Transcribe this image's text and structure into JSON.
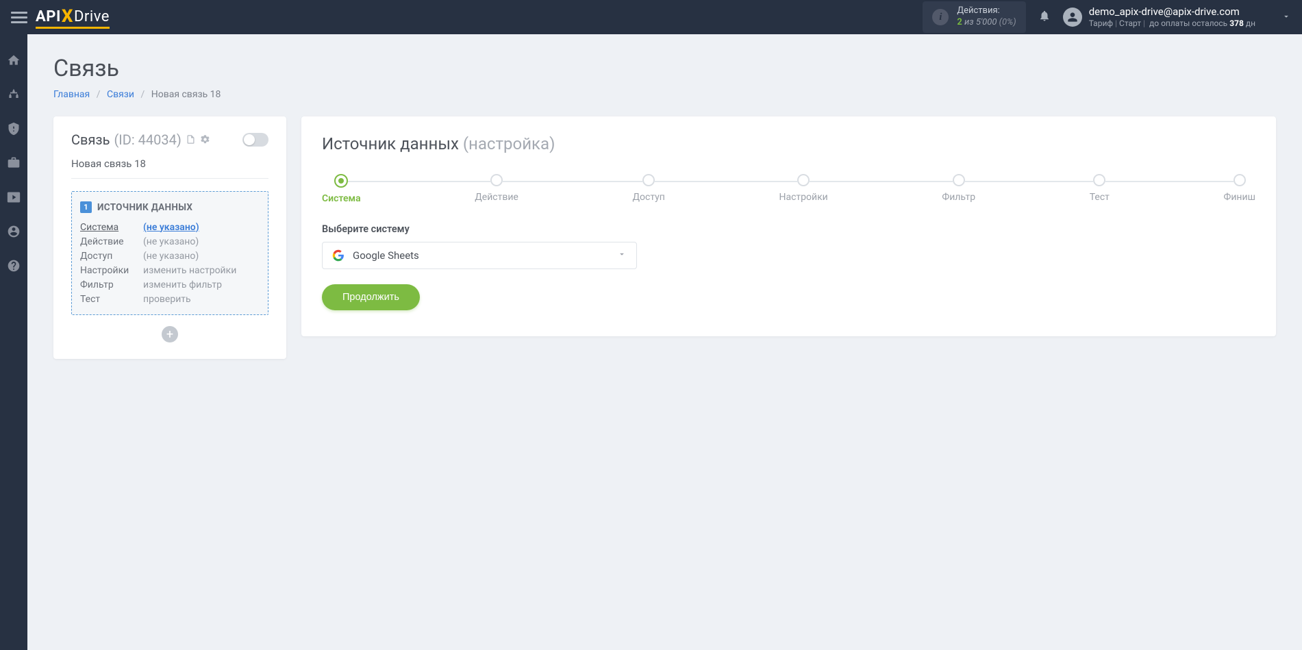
{
  "header": {
    "logo_prefix": "API",
    "logo_x": "X",
    "logo_suffix": "Drive",
    "actions": {
      "label": "Действия:",
      "used": "2",
      "of_word": "из",
      "total": "5'000",
      "percent": "(0%)"
    },
    "user": {
      "email": "demo_apix-drive@apix-drive.com",
      "tariff_label": "Тариф",
      "tariff_name": "Старт",
      "remaining_label": "до оплаты осталось",
      "days": "378",
      "days_suffix": "дн"
    }
  },
  "page": {
    "title": "Связь",
    "breadcrumb": {
      "home": "Главная",
      "connections": "Связи",
      "current": "Новая связь 18"
    }
  },
  "left_panel": {
    "conn_word": "Связь",
    "id_label": "(ID: 44034)",
    "conn_name": "Новая связь 18",
    "source_box_title": "ИСТОЧНИК ДАННЫХ",
    "source_num": "1",
    "rows": [
      {
        "key": "Система",
        "val": "(не указано)",
        "type": "link",
        "active_key": true
      },
      {
        "key": "Действие",
        "val": "(не указано)",
        "type": "muted"
      },
      {
        "key": "Доступ",
        "val": "(не указано)",
        "type": "muted"
      },
      {
        "key": "Настройки",
        "val": "изменить настройки",
        "type": "action"
      },
      {
        "key": "Фильтр",
        "val": "изменить фильтр",
        "type": "action"
      },
      {
        "key": "Тест",
        "val": "проверить",
        "type": "action"
      }
    ]
  },
  "right_panel": {
    "title": "Источник данных",
    "subtitle": "(настройка)",
    "steps": [
      "Система",
      "Действие",
      "Доступ",
      "Настройки",
      "Фильтр",
      "Тест",
      "Финиш"
    ],
    "active_step_index": 0,
    "field_label": "Выберите систему",
    "selected_system": "Google Sheets",
    "continue_btn": "Продолжить"
  }
}
